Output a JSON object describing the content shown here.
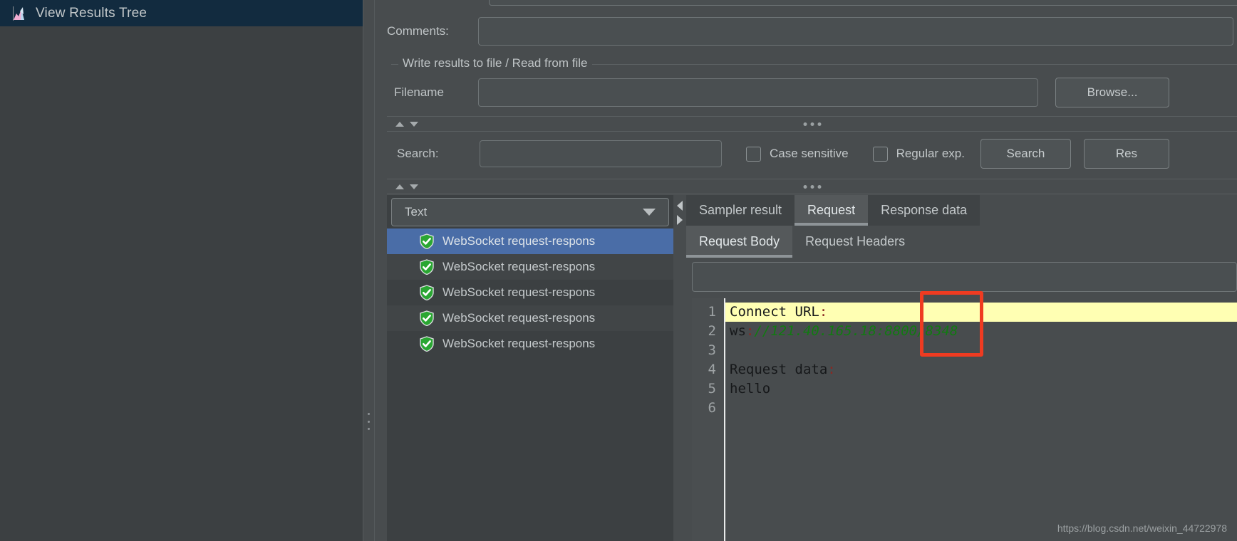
{
  "window": {
    "title": "View Results Tree",
    "title_icon": "chart-icon"
  },
  "form": {
    "comments_label": "Comments:",
    "comments_value": "",
    "comments_placeholder": "",
    "write_group_label": "Write results to file / Read from file",
    "filename_label": "Filename",
    "filename_value": "",
    "filename_placeholder": "",
    "browse_label": "Browse..."
  },
  "search": {
    "label": "Search:",
    "value": "",
    "placeholder": "",
    "case_sensitive_label": "Case sensitive",
    "case_sensitive_checked": false,
    "regular_exp_label": "Regular exp.",
    "regular_exp_checked": false,
    "search_button": "Search",
    "reset_button": "Res"
  },
  "tree": {
    "renderer_selected": "Text",
    "renderer_options": [
      "Text"
    ],
    "items": [
      {
        "label": "WebSocket request-respons",
        "status": "success",
        "selected": true
      },
      {
        "label": "WebSocket request-respons",
        "status": "success",
        "selected": false
      },
      {
        "label": "WebSocket request-respons",
        "status": "success",
        "selected": false
      },
      {
        "label": "WebSocket request-respons",
        "status": "success",
        "selected": false
      },
      {
        "label": "WebSocket request-respons",
        "status": "success",
        "selected": false
      }
    ]
  },
  "tabs": {
    "main": [
      {
        "label": "Sampler result",
        "active": false
      },
      {
        "label": "Request",
        "active": true
      },
      {
        "label": "Response data",
        "active": false
      }
    ],
    "sub": [
      {
        "label": "Request Body",
        "active": true
      },
      {
        "label": "Request Headers",
        "active": false
      }
    ]
  },
  "editor": {
    "find_value": "",
    "find_placeholder": "",
    "line_numbers": [
      "1",
      "2",
      "3",
      "4",
      "5",
      "6"
    ],
    "lines": [
      {
        "n": "1",
        "text": "Connect URL",
        "punct": ":",
        "url": "",
        "highlight": true
      },
      {
        "n": "2",
        "text": "ws",
        "punct": ":",
        "url": "//121.40.165.18:8800/8348",
        "highlight": false
      },
      {
        "n": "3",
        "text": "",
        "punct": "",
        "url": "",
        "highlight": false
      },
      {
        "n": "4",
        "text": "Request data",
        "punct": ":",
        "url": "",
        "highlight": false
      },
      {
        "n": "5",
        "text": "hello",
        "punct": "",
        "url": "",
        "highlight": false
      },
      {
        "n": "6",
        "text": "",
        "punct": "",
        "url": "",
        "highlight": false
      }
    ]
  },
  "annotation": {
    "type": "red-rectangle",
    "color": "#ef3b21"
  },
  "watermark": "https://blog.csdn.net/weixin_44722978",
  "colors": {
    "title_bar": "#122b3f",
    "background": "#484c4e",
    "panel": "#3c4042",
    "selection": "#4a6da7",
    "highlight": "#ffffb3",
    "url_green": "#117a11",
    "annotation_red": "#ef3b21",
    "success_green": "#2aa632"
  }
}
